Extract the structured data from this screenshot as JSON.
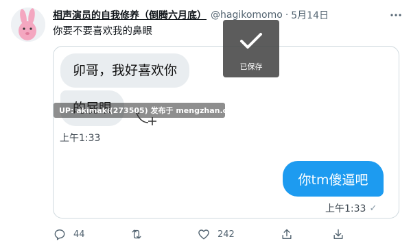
{
  "tweet": {
    "display_name": "相声演员的自我修养（倒腾六月底）",
    "handle": "@hagikomomo",
    "separator": "·",
    "date": "5月14日",
    "text": "你要不要喜欢我的鼻眼"
  },
  "chat": {
    "incoming": [
      "卯哥，我好喜欢你",
      "的屁眼"
    ],
    "incoming_time": "上午1:33",
    "outgoing": "你tm傻逼吧",
    "outgoing_time": "上午1:33",
    "read_check": "✓"
  },
  "watermark": "UP: akimaki(273505) 发布于 mengzhan.cc",
  "toast": {
    "label": "已保存"
  },
  "actions": {
    "reply_count": "44",
    "like_count": "242"
  },
  "colors": {
    "accent": "#1d9bf0",
    "incoming_bubble": "#e9edf0",
    "muted_text": "#536471"
  },
  "icons": [
    "bunny-avatar",
    "more-icon",
    "reply-icon",
    "retweet-icon",
    "like-icon",
    "share-icon",
    "download-icon",
    "checkmark-icon",
    "cursor-add-icon"
  ]
}
